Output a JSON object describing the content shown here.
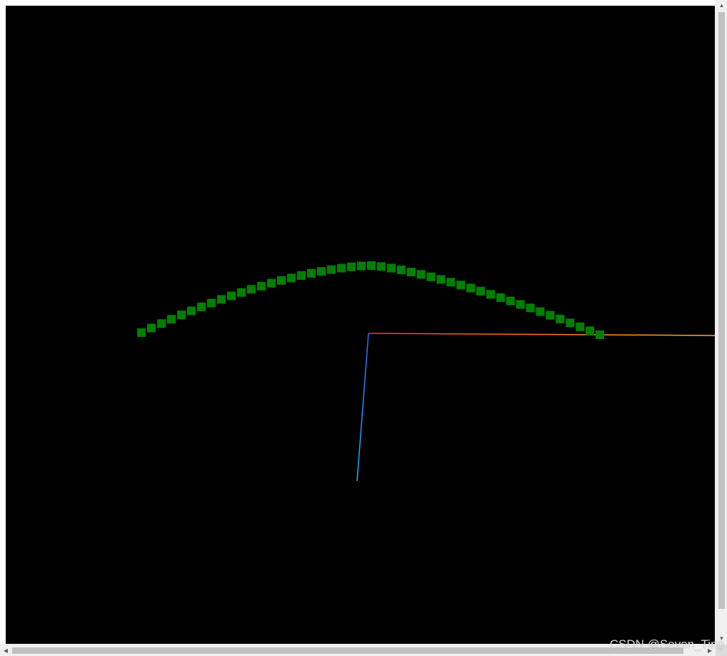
{
  "scene": {
    "background_color": "#000000",
    "axes": {
      "x_color": "#ff3b1f",
      "x_end_color": "#ffb020",
      "y_color": "#8fd000",
      "y_end_color": "#c8d800",
      "z_color": "#2f6bff",
      "z_end_color": "#19b6ff"
    },
    "points": {
      "count": 47,
      "color": "#008000",
      "shape": "square",
      "curve": "arch"
    }
  },
  "scrollbars": {
    "vertical_up_icon": "triangle-up",
    "vertical_down_icon": "triangle-down",
    "horizontal_left_icon": "triangle-left",
    "horizontal_right_icon": "triangle-right"
  },
  "watermark": {
    "text": "CSDN @Seven_Ting"
  }
}
